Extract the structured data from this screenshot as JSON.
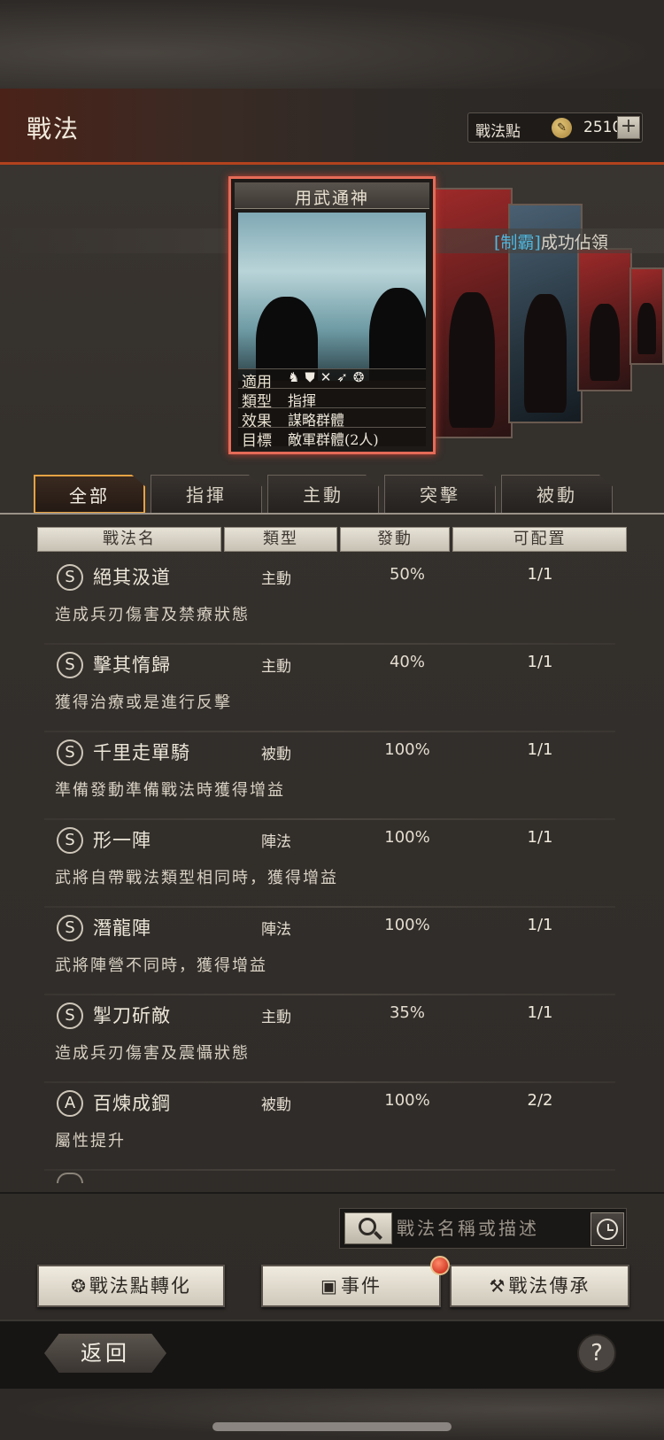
{
  "header": {
    "title": "戰法",
    "points_label": "戰法點",
    "points_value": "2510",
    "plus_label": "+"
  },
  "notice": {
    "tag": "[制霸]",
    "text": "成功佔領"
  },
  "featured_card": {
    "title": "用武通神",
    "rows": [
      {
        "key": "適用",
        "value": ""
      },
      {
        "key": "類型",
        "value": "指揮"
      },
      {
        "key": "效果",
        "value": "謀略群體"
      },
      {
        "key": "目標",
        "value": "敵軍群體(2人)"
      }
    ],
    "unit_icons": [
      "cavalry-icon",
      "shield-icon",
      "bow-icon",
      "spear-icon",
      "wheel-icon"
    ]
  },
  "tabs": [
    {
      "label": "全部",
      "active": true
    },
    {
      "label": "指揮",
      "active": false
    },
    {
      "label": "主動",
      "active": false
    },
    {
      "label": "突擊",
      "active": false
    },
    {
      "label": "被動",
      "active": false
    }
  ],
  "table": {
    "columns": [
      "戰法名",
      "類型",
      "發動",
      "可配置"
    ],
    "rows": [
      {
        "grade": "S",
        "name": "絕其汲道",
        "type": "主動",
        "activation": "50%",
        "slots": "1/1",
        "desc": "造成兵刃傷害及禁療狀態"
      },
      {
        "grade": "S",
        "name": "擊其惰歸",
        "type": "主動",
        "activation": "40%",
        "slots": "1/1",
        "desc": "獲得治療或是進行反擊"
      },
      {
        "grade": "S",
        "name": "千里走單騎",
        "type": "被動",
        "activation": "100%",
        "slots": "1/1",
        "desc": "準備發動準備戰法時獲得增益"
      },
      {
        "grade": "S",
        "name": "形一陣",
        "type": "陣法",
        "activation": "100%",
        "slots": "1/1",
        "desc": "武將自帶戰法類型相同時，獲得增益"
      },
      {
        "grade": "S",
        "name": "潛龍陣",
        "type": "陣法",
        "activation": "100%",
        "slots": "1/1",
        "desc": "武將陣營不同時，獲得增益"
      },
      {
        "grade": "S",
        "name": "掣刀斫敵",
        "type": "主動",
        "activation": "35%",
        "slots": "1/1",
        "desc": "造成兵刃傷害及震懾狀態"
      },
      {
        "grade": "A",
        "name": "百煉成鋼",
        "type": "被動",
        "activation": "100%",
        "slots": "2/2",
        "desc": "屬性提升"
      }
    ]
  },
  "search": {
    "placeholder": "戰法名稱或描述"
  },
  "actions": {
    "convert_label": "戰法點轉化",
    "events_label": "事件",
    "inherit_label": "戰法傳承"
  },
  "footer": {
    "back_label": "返回",
    "help_label": "?"
  },
  "colors": {
    "accent_orange": "#e5a243",
    "card_border": "#e46b57",
    "notice_tag": "#4fb8e0",
    "header_rule": "#b2421e"
  }
}
